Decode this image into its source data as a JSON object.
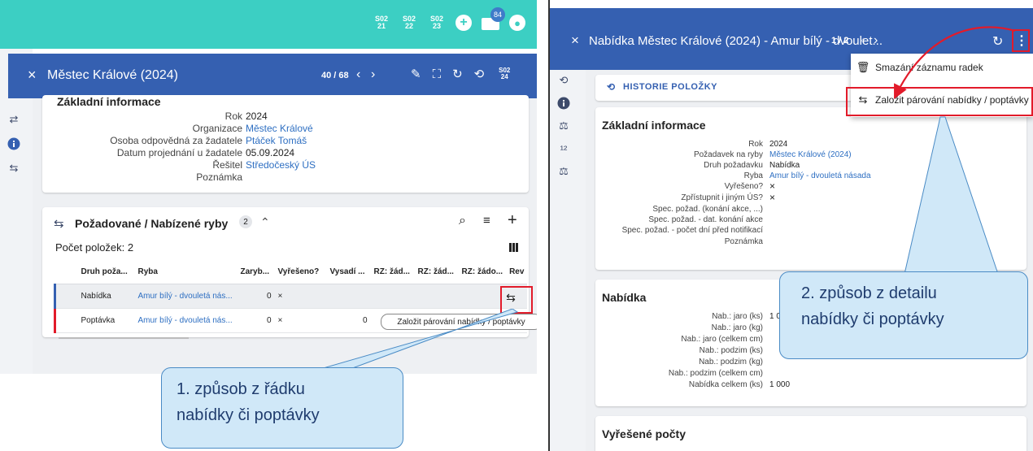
{
  "left": {
    "topbar": {
      "shortcuts": [
        {
          "top": "S02",
          "bottom": "21"
        },
        {
          "top": "S02",
          "bottom": "22"
        },
        {
          "top": "S02",
          "bottom": "23"
        }
      ],
      "mail_badge": "84"
    },
    "header": {
      "close": "×",
      "title": "Městec Králové (2024)",
      "counter": "40 / 68",
      "prev": "‹",
      "next": "›",
      "s02_top": "S02",
      "s02_bottom": "24"
    },
    "basic_info": {
      "title": "Základní informace",
      "fields": [
        {
          "label": "Rok",
          "value": "2024",
          "link": false
        },
        {
          "label": "Organizace",
          "value": "Městec Králové",
          "link": true
        },
        {
          "label": "Osoba odpovědná za žadatele",
          "value": "Ptáček Tomáš",
          "link": true
        },
        {
          "label": "Datum projednání u žadatele",
          "value": "05.09.2024",
          "link": false
        },
        {
          "label": "Řešitel",
          "value": "Středočeský ÚS",
          "link": true
        },
        {
          "label": "Poznámka",
          "value": "",
          "link": false
        }
      ]
    },
    "fish_section": {
      "title": "Požadované / Nabízené ryby",
      "badge": "2",
      "count_label": "Počet položek: 2",
      "columns": [
        "Druh poža...",
        "Ryba",
        "Zaryb...",
        "Vyřešeno?",
        "Vysadí ...",
        "RZ: žád...",
        "RZ: žád...",
        "RZ: žádo...",
        "Rev"
      ],
      "rows": [
        {
          "type": "Nabídka",
          "fish": "Amur bílý - dvouletá nás...",
          "zaryb": "0",
          "vyreseno": "×",
          "vysadi": "",
          "rz1": "",
          "rz2": "",
          "rz3": "",
          "rev": ""
        },
        {
          "type": "Poptávka",
          "fish": "Amur bílý - dvouletá nás...",
          "zaryb": "0",
          "vyreseno": "×",
          "vysadi": "0",
          "rz1": "",
          "rz2": "",
          "rz3": "",
          "rev": ""
        }
      ]
    },
    "tooltip": "Založit párování nabídky / poptávky"
  },
  "right": {
    "header": {
      "close": "×",
      "title": "Nabídka Městec Králové (2024) - Amur bílý - dvoulet...",
      "counter": "1 / 2",
      "prev": "‹",
      "next": "›"
    },
    "history": "HISTORIE POLOŽKY",
    "basic_info": {
      "title": "Základní informace",
      "fields": [
        {
          "label": "Rok",
          "value": "2024",
          "link": false
        },
        {
          "label": "Požadavek na ryby",
          "value": "Městec Králové (2024)",
          "link": true
        },
        {
          "label": "Druh požadavku",
          "value": "Nabídka",
          "link": false
        },
        {
          "label": "Ryba",
          "value": "Amur bílý - dvouletá násada",
          "link": true
        },
        {
          "label": "Vyřešeno?",
          "value": "×",
          "link": false
        },
        {
          "label": "Zpřístupnit i jiným ÚS?",
          "value": "×",
          "link": false
        },
        {
          "label": "Spec. požad. (konání akce, ...)",
          "value": "",
          "link": false
        },
        {
          "label": "Spec. požad. - dat. konání akce",
          "value": "",
          "link": false
        },
        {
          "label": "Spec. požad. - počet dní před notifikací",
          "value": "",
          "link": false
        },
        {
          "label": "Poznámka",
          "value": "",
          "link": false
        }
      ]
    },
    "offer": {
      "title": "Nabídka",
      "fields": [
        {
          "label": "Nab.: jaro (ks)",
          "value": "1 0"
        },
        {
          "label": "Nab.: jaro (kg)",
          "value": ""
        },
        {
          "label": "Nab.: jaro (celkem cm)",
          "value": ""
        },
        {
          "label": "Nab.: podzim (ks)",
          "value": ""
        },
        {
          "label": "Nab.: podzim (kg)",
          "value": ""
        },
        {
          "label": "Nab.: podzim (celkem cm)",
          "value": ""
        },
        {
          "label": "Nabídka celkem (ks)",
          "value": "1 000"
        }
      ]
    },
    "solved": {
      "title": "Vyřešené počty"
    },
    "menu": {
      "items": [
        "Smazání záznamu radek",
        "Založit párování nabídky / poptávky"
      ]
    }
  },
  "callouts": {
    "one_line1": "1. způsob z řádku",
    "one_line2": "nabídky či poptávky",
    "two_line1": "2. způsob z detailu",
    "two_line2": "nabídky či poptávky"
  },
  "colors": {
    "teal": "#3ccfc3",
    "blue": "#3560b1",
    "link": "#2e6fc2",
    "red": "#e21b2a",
    "callout": "#d0e8f8"
  }
}
